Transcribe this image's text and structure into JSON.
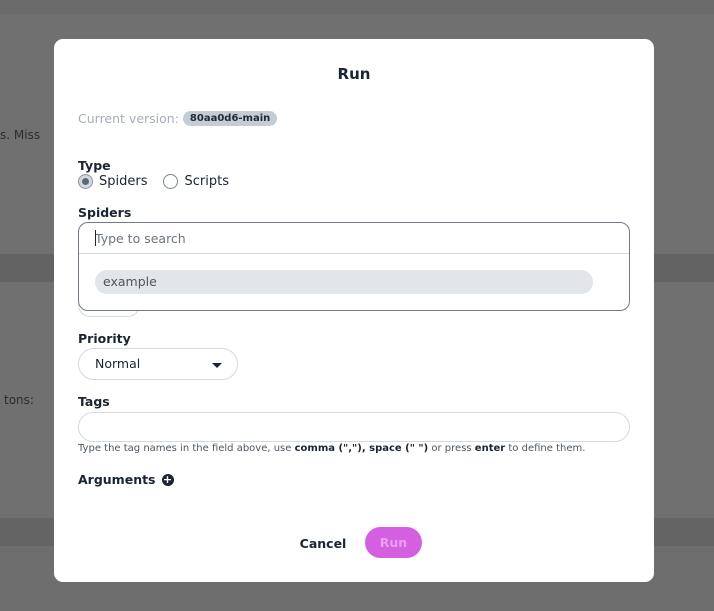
{
  "background": {
    "fragment_1": "s.  Miss",
    "fragment_2": "tons:"
  },
  "modal": {
    "title": "Run",
    "current_version_label": "Current version:",
    "current_version_tag": "80aa0d6-main",
    "type_label": "Type",
    "type_options": [
      {
        "label": "Spiders",
        "selected": true
      },
      {
        "label": "Scripts",
        "selected": false
      }
    ],
    "spiders_label": "Spiders",
    "spiders_search": {
      "value": "",
      "placeholder": "Type to search",
      "options": [
        "example"
      ]
    },
    "priority_label": "Priority",
    "priority_value": "Normal",
    "tags_label": "Tags",
    "tags_value": "",
    "tags_help": {
      "part1": "Type the tag names in the field above, use ",
      "comma": "comma (\",\")",
      "sep": ", ",
      "space": "space (\" \")",
      "part2": " or press ",
      "enter": "enter",
      "part3": " to define them."
    },
    "arguments_label": "Arguments",
    "arguments_add_icon": "+",
    "cancel_label": "Cancel",
    "run_label": "Run"
  },
  "colors": {
    "accent": "#d45fe0",
    "text": "#1a2433",
    "overlay": "#6b6b6b"
  }
}
